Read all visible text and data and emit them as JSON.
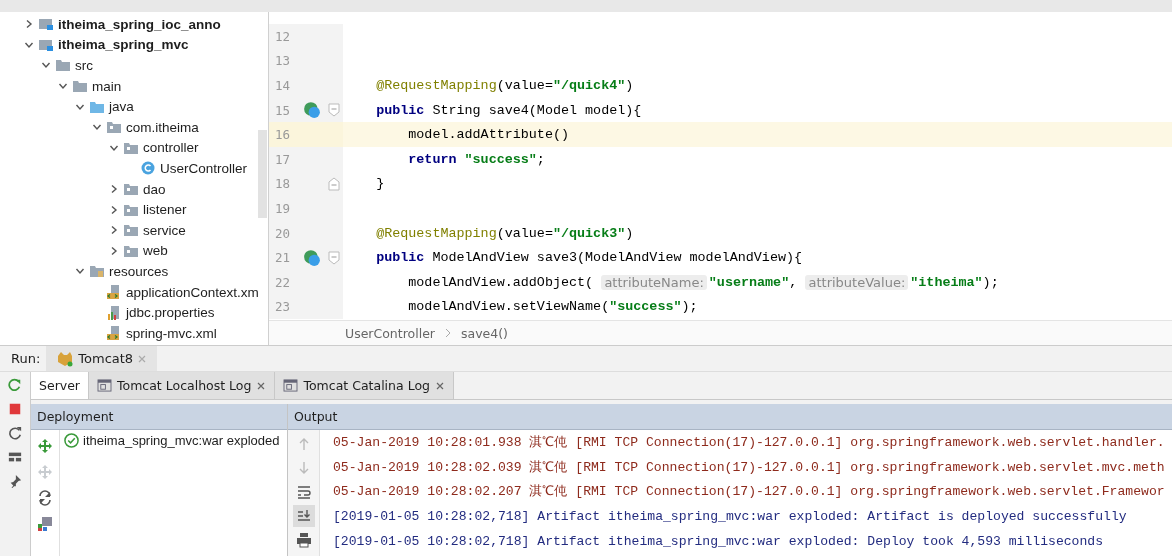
{
  "project_tree": [
    {
      "label": "itheima_spring_ioc_anno",
      "kind": "module",
      "expanded": false,
      "bold": true
    },
    {
      "label": "itheima_spring_mvc",
      "kind": "module",
      "expanded": true,
      "bold": true,
      "children": [
        {
          "label": "src",
          "kind": "folder",
          "expanded": true,
          "bold": false,
          "children": [
            {
              "label": "main",
              "kind": "folder",
              "expanded": true,
              "bold": false,
              "children": [
                {
                  "label": "java",
                  "kind": "source",
                  "expanded": true,
                  "bold": false,
                  "children": [
                    {
                      "label": "com.itheima",
                      "kind": "package",
                      "expanded": true,
                      "bold": false,
                      "children": [
                        {
                          "label": "controller",
                          "kind": "package",
                          "expanded": true,
                          "bold": false,
                          "children": [
                            {
                              "label": "UserController",
                              "kind": "class",
                              "bold": false
                            }
                          ]
                        },
                        {
                          "label": "dao",
                          "kind": "package",
                          "expanded": false,
                          "bold": false
                        },
                        {
                          "label": "listener",
                          "kind": "package",
                          "expanded": false,
                          "bold": false
                        },
                        {
                          "label": "service",
                          "kind": "package",
                          "expanded": false,
                          "bold": false
                        },
                        {
                          "label": "web",
                          "kind": "package",
                          "expanded": false,
                          "bold": false
                        }
                      ]
                    }
                  ]
                },
                {
                  "label": "resources",
                  "kind": "resources",
                  "expanded": true,
                  "bold": false,
                  "children": [
                    {
                      "label": "applicationContext.xm",
                      "kind": "xml",
                      "bold": false
                    },
                    {
                      "label": "jdbc.properties",
                      "kind": "properties",
                      "bold": false
                    },
                    {
                      "label": "spring-mvc.xml",
                      "kind": "xml",
                      "bold": false
                    }
                  ]
                }
              ]
            }
          ]
        }
      ]
    }
  ],
  "editor": {
    "lines": [
      {
        "number": "12",
        "current": false
      },
      {
        "number": "13",
        "current": false
      },
      {
        "number": "14",
        "current": false,
        "in_body": false,
        "tokens": [
          {
            "kind": "annotation",
            "text": "@RequestMapping"
          },
          {
            "kind": "plain",
            "text": "(value="
          },
          {
            "kind": "string",
            "text": "\"/quick4\""
          },
          {
            "kind": "plain",
            "text": ")"
          }
        ]
      },
      {
        "number": "15",
        "current": false,
        "in_body": false,
        "bean": true,
        "fold_start": true,
        "tokens": [
          {
            "kind": "keyword",
            "text": "public"
          },
          {
            "kind": "plain",
            "text": "String save4(Model model){"
          }
        ]
      },
      {
        "number": "16",
        "current": true,
        "in_body": true,
        "tokens": [
          {
            "kind": "plain",
            "text": "model.addAttribute()"
          }
        ]
      },
      {
        "number": "17",
        "current": false,
        "in_body": true,
        "tokens": [
          {
            "kind": "keyword",
            "text": "return"
          },
          {
            "kind": "string",
            "text": "\"success\""
          },
          {
            "kind": "plain",
            "text": ";"
          }
        ]
      },
      {
        "number": "18",
        "current": false,
        "in_body": false,
        "fold_end": true,
        "tokens": [
          {
            "kind": "plain",
            "text": "}"
          }
        ]
      },
      {
        "number": "19",
        "current": false
      },
      {
        "number": "20",
        "current": false,
        "in_body": false,
        "tokens": [
          {
            "kind": "annotation",
            "text": "@RequestMapping"
          },
          {
            "kind": "plain",
            "text": "(value="
          },
          {
            "kind": "string",
            "text": "\"/quick3\""
          },
          {
            "kind": "plain",
            "text": ")"
          }
        ]
      },
      {
        "number": "21",
        "current": false,
        "in_body": false,
        "bean": true,
        "fold_start": true,
        "tokens": [
          {
            "kind": "keyword",
            "text": "public"
          },
          {
            "kind": "plain",
            "text": "ModelAndView save3(ModelAndView modelAndView){"
          }
        ]
      },
      {
        "number": "22",
        "current": false,
        "in_body": true,
        "tokens": [
          {
            "kind": "plain",
            "text": "modelAndView.addObject("
          },
          {
            "kind": "hint",
            "text": "attributeName:"
          },
          {
            "kind": "string",
            "text": "\"username\""
          },
          {
            "kind": "plain",
            "text": ","
          },
          {
            "kind": "hint",
            "text": "attributeValue:"
          },
          {
            "kind": "string",
            "text": "\"itheima\""
          },
          {
            "kind": "plain",
            "text": ");"
          }
        ]
      },
      {
        "number": "23",
        "current": false,
        "in_body": true,
        "tokens": [
          {
            "kind": "plain",
            "text": "modelAndView.setViewName("
          },
          {
            "kind": "string",
            "text": "\"success\""
          },
          {
            "kind": "plain",
            "text": ");"
          }
        ]
      }
    ],
    "breadcrumb": [
      "UserController",
      "save4()"
    ]
  },
  "run": {
    "label": "Run:",
    "config_tab": "Tomcat8",
    "tabs": [
      {
        "label": "Server",
        "selected": true,
        "closable": false
      },
      {
        "label": "Tomcat Localhost Log",
        "selected": false,
        "closable": true
      },
      {
        "label": "Tomcat Catalina Log",
        "selected": false,
        "closable": true
      }
    ],
    "deployment": {
      "title": "Deployment",
      "items": [
        {
          "label": "itheima_spring_mvc:war exploded",
          "deployed": true
        }
      ]
    },
    "output": {
      "title": "Output",
      "lines": [
        {
          "kind": "error",
          "text": "05-Jan-2019 10:28:01.938 淇℃伅 [RMI TCP Connection(17)-127.0.0.1] org.springframework.web.servlet.handler."
        },
        {
          "kind": "error",
          "text": "05-Jan-2019 10:28:02.039 淇℃伅 [RMI TCP Connection(17)-127.0.0.1] org.springframework.web.servlet.mvc.meth"
        },
        {
          "kind": "error",
          "text": "05-Jan-2019 10:28:02.207 淇℃伅 [RMI TCP Connection(17)-127.0.0.1] org.springframework.web.servlet.Framewor"
        },
        {
          "kind": "info",
          "text": "[2019-01-05 10:28:02,718] Artifact itheima_spring_mvc:war exploded: Artifact is deployed successfully"
        },
        {
          "kind": "info",
          "text": "[2019-01-05 10:28:02,718] Artifact itheima_spring_mvc:war exploded: Deploy took 4,593 milliseconds"
        }
      ]
    }
  }
}
